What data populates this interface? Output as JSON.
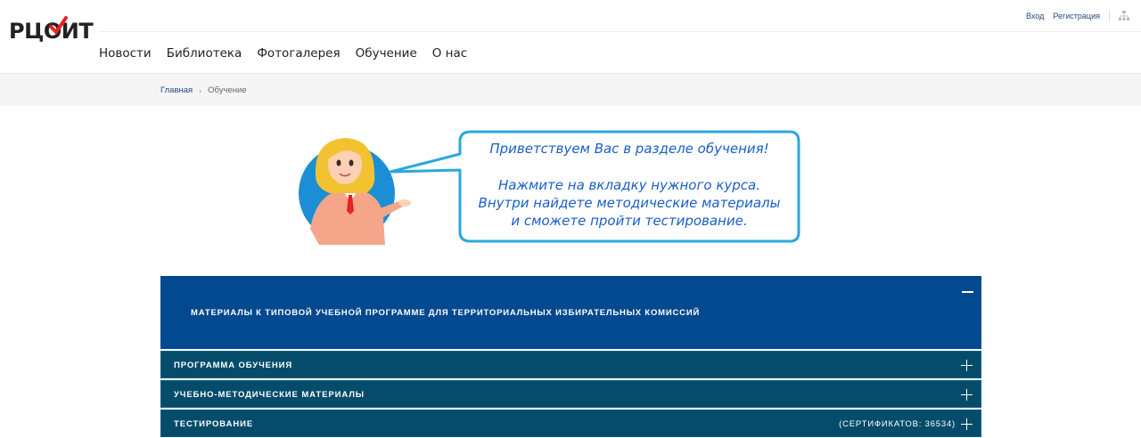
{
  "header": {
    "logo_text": "РЦОИТ",
    "top_links": {
      "login": "Вход",
      "register": "Регистрация"
    },
    "nav": [
      "Новости",
      "Библиотека",
      "Фотогалерея",
      "Обучение",
      "О нас"
    ]
  },
  "breadcrumb": {
    "home": "Главная",
    "separator": "›",
    "current": "Обучение"
  },
  "banner": {
    "line1": "Приветствуем Вас в разделе обучения!",
    "line2": "Нажмите на вкладку нужного курса.",
    "line3": "Внутри найдете методические материалы",
    "line4": "и сможете пройти тестирование."
  },
  "accordion": {
    "header_title": "МАТЕРИАЛЫ К ТИПОВОЙ УЧЕБНОЙ ПРОГРАММЕ ДЛЯ ТЕРРИТОРИАЛЬНЫХ ИЗБИРАТЕЛЬНЫХ КОМИССИЙ",
    "items": [
      {
        "label": "ПРОГРАММА ОБУЧЕНИЯ",
        "right": ""
      },
      {
        "label": "УЧЕБНО-МЕТОДИЧЕСКИЕ МАТЕРИАЛЫ",
        "right": ""
      },
      {
        "label": "ТЕСТИРОВАНИЕ",
        "right": "(СЕРТИФИКАТОВ: 36534)"
      }
    ]
  },
  "colors": {
    "accent_blue": "#03498f",
    "row_teal": "#054c6b",
    "logo_check_red": "#e52421",
    "bubble_border": "#2aa8dc",
    "bubble_text": "#1a5fc8"
  },
  "icons": [
    "sitemap-icon",
    "chevron-right-icon",
    "minus-icon",
    "plus-icon",
    "checkmark-icon"
  ]
}
